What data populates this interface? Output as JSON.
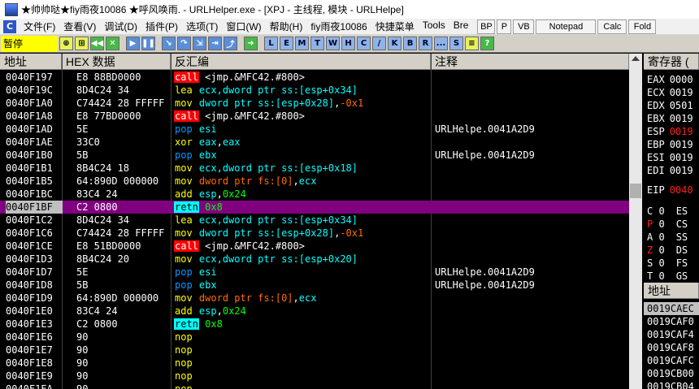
{
  "title": "★帅帅哒★fiy雨夜10086 ★呼风唤雨. - URLHelper.exe - [XPJ - 主线程, 模块 - URLHelpe]",
  "menu": {
    "items": [
      "文件(F)",
      "查看(V)",
      "调试(D)",
      "插件(P)",
      "选项(T)",
      "窗口(W)",
      "帮助(H)",
      "fiy雨夜10086",
      "快捷菜单",
      "Tools",
      "Bre"
    ],
    "right_buttons": [
      "BP",
      "P",
      "VB",
      "Notepad",
      "Calc",
      "Fold"
    ]
  },
  "toolbar": {
    "status": "暂停",
    "letter_buttons": [
      "L",
      "E",
      "M",
      "T",
      "W",
      "H",
      "C",
      "/",
      "K",
      "B",
      "R",
      "...",
      "S"
    ]
  },
  "headers": {
    "address": "地址",
    "hex": "HEX 数据",
    "disasm": "反汇编",
    "comment": "注释",
    "registers": "寄存器 (",
    "stack": "地址"
  },
  "colors": {
    "selected_row": "#800080",
    "call_bg": "#ff0000",
    "retn_bg": "#00ffff",
    "pause_bg": "#ffff00"
  },
  "disasm_rows": [
    {
      "addr": "0040F197",
      "hex": "E8 88BD0000",
      "mn": "call",
      "kind": "call",
      "ops": [
        [
          "<jmp.&MFC42.#800>",
          "txt"
        ]
      ],
      "cmt": ""
    },
    {
      "addr": "0040F19C",
      "hex": "8D4C24 34",
      "mn": "lea",
      "kind": "def",
      "ops": [
        [
          "ecx",
          "reg"
        ],
        [
          ",dword ptr ss:[esp+0x34]",
          "reg"
        ]
      ],
      "cmt": ""
    },
    {
      "addr": "0040F1A0",
      "hex": "C74424 28 FFFFF",
      "mn": "mov",
      "kind": "def",
      "ops": [
        [
          "dword ptr ss:[esp+0x28]",
          "reg"
        ],
        [
          ",",
          "txt"
        ],
        [
          "-0x1",
          "neg"
        ]
      ],
      "cmt": ""
    },
    {
      "addr": "0040F1A8",
      "hex": "E8 77BD0000",
      "mn": "call",
      "kind": "call",
      "ops": [
        [
          "<jmp.&MFC42.#800>",
          "txt"
        ]
      ],
      "cmt": ""
    },
    {
      "addr": "0040F1AD",
      "hex": "5E",
      "mn": "pop",
      "kind": "pop",
      "ops": [
        [
          "esi",
          "reg"
        ]
      ],
      "cmt": "URLHelpe.0041A2D9"
    },
    {
      "addr": "0040F1AE",
      "hex": "33C0",
      "mn": "xor",
      "kind": "def",
      "ops": [
        [
          "eax",
          "reg"
        ],
        [
          ",",
          "txt"
        ],
        [
          "eax",
          "reg"
        ]
      ],
      "cmt": ""
    },
    {
      "addr": "0040F1B0",
      "hex": "5B",
      "mn": "pop",
      "kind": "pop",
      "ops": [
        [
          "ebx",
          "reg"
        ]
      ],
      "cmt": "URLHelpe.0041A2D9"
    },
    {
      "addr": "0040F1B1",
      "hex": "8B4C24 18",
      "mn": "mov",
      "kind": "def",
      "ops": [
        [
          "ecx",
          "reg"
        ],
        [
          ",dword ptr ss:[esp+0x18]",
          "reg"
        ]
      ],
      "cmt": ""
    },
    {
      "addr": "0040F1B5",
      "hex": "64:890D 000000",
      "mn": "mov",
      "kind": "def",
      "ops": [
        [
          "dword ptr fs:[0]",
          "neg"
        ],
        [
          ",",
          "txt"
        ],
        [
          "ecx",
          "reg"
        ]
      ],
      "cmt": ""
    },
    {
      "addr": "0040F1BC",
      "hex": "83C4 24",
      "mn": "add",
      "kind": "def",
      "ops": [
        [
          "esp",
          "reg"
        ],
        [
          ",",
          "txt"
        ],
        [
          "0x24",
          "num"
        ]
      ],
      "cmt": ""
    },
    {
      "addr": "0040F1BF",
      "hex": "C2 0800",
      "mn": "retn",
      "kind": "ret",
      "ops": [
        [
          "0x8",
          "num"
        ]
      ],
      "cmt": "",
      "selected": true
    },
    {
      "addr": "0040F1C2",
      "hex": "8D4C24 34",
      "mn": "lea",
      "kind": "def",
      "ops": [
        [
          "ecx",
          "reg"
        ],
        [
          ",dword ptr ss:[esp+0x34]",
          "reg"
        ]
      ],
      "cmt": ""
    },
    {
      "addr": "0040F1C6",
      "hex": "C74424 28 FFFFF",
      "mn": "mov",
      "kind": "def",
      "ops": [
        [
          "dword ptr ss:[esp+0x28]",
          "reg"
        ],
        [
          ",",
          "txt"
        ],
        [
          "-0x1",
          "neg"
        ]
      ],
      "cmt": ""
    },
    {
      "addr": "0040F1CE",
      "hex": "E8 51BD0000",
      "mn": "call",
      "kind": "call",
      "ops": [
        [
          "<jmp.&MFC42.#800>",
          "txt"
        ]
      ],
      "cmt": ""
    },
    {
      "addr": "0040F1D3",
      "hex": "8B4C24 20",
      "mn": "mov",
      "kind": "def",
      "ops": [
        [
          "ecx",
          "reg"
        ],
        [
          ",dword ptr ss:[esp+0x20]",
          "reg"
        ]
      ],
      "cmt": ""
    },
    {
      "addr": "0040F1D7",
      "hex": "5E",
      "mn": "pop",
      "kind": "pop",
      "ops": [
        [
          "esi",
          "reg"
        ]
      ],
      "cmt": "URLHelpe.0041A2D9"
    },
    {
      "addr": "0040F1D8",
      "hex": "5B",
      "mn": "pop",
      "kind": "pop",
      "ops": [
        [
          "ebx",
          "reg"
        ]
      ],
      "cmt": "URLHelpe.0041A2D9"
    },
    {
      "addr": "0040F1D9",
      "hex": "64:890D 000000",
      "mn": "mov",
      "kind": "def",
      "ops": [
        [
          "dword ptr fs:[0]",
          "neg"
        ],
        [
          ",",
          "txt"
        ],
        [
          "ecx",
          "reg"
        ]
      ],
      "cmt": ""
    },
    {
      "addr": "0040F1E0",
      "hex": "83C4 24",
      "mn": "add",
      "kind": "def",
      "ops": [
        [
          "esp",
          "reg"
        ],
        [
          ",",
          "txt"
        ],
        [
          "0x24",
          "num"
        ]
      ],
      "cmt": ""
    },
    {
      "addr": "0040F1E3",
      "hex": "C2 0800",
      "mn": "retn",
      "kind": "ret",
      "ops": [
        [
          "0x8",
          "num"
        ]
      ],
      "cmt": ""
    },
    {
      "addr": "0040F1E6",
      "hex": "90",
      "mn": "nop",
      "kind": "def",
      "ops": [],
      "cmt": ""
    },
    {
      "addr": "0040F1E7",
      "hex": "90",
      "mn": "nop",
      "kind": "def",
      "ops": [],
      "cmt": ""
    },
    {
      "addr": "0040F1E8",
      "hex": "90",
      "mn": "nop",
      "kind": "def",
      "ops": [],
      "cmt": ""
    },
    {
      "addr": "0040F1E9",
      "hex": "90",
      "mn": "nop",
      "kind": "def",
      "ops": [],
      "cmt": ""
    },
    {
      "addr": "0040F1EA",
      "hex": "90",
      "mn": "nop",
      "kind": "def",
      "ops": [],
      "cmt": ""
    }
  ],
  "registers": [
    {
      "name": "EAX",
      "val": "0000",
      "red": false
    },
    {
      "name": "ECX",
      "val": "0019",
      "red": false
    },
    {
      "name": "EDX",
      "val": "0501",
      "red": false
    },
    {
      "name": "EBX",
      "val": "0019",
      "red": false
    },
    {
      "name": "ESP",
      "val": "0019",
      "red": true
    },
    {
      "name": "EBP",
      "val": "0019",
      "red": false
    },
    {
      "name": "ESI",
      "val": "0019",
      "red": false
    },
    {
      "name": "EDI",
      "val": "0019",
      "red": false
    }
  ],
  "eip": {
    "name": "EIP",
    "val": "0040"
  },
  "flags": [
    {
      "flag": "C",
      "val": "0",
      "seg": "ES",
      "red": false
    },
    {
      "flag": "P",
      "val": "0",
      "seg": "CS",
      "red": true
    },
    {
      "flag": "A",
      "val": "0",
      "seg": "SS",
      "red": false
    },
    {
      "flag": "Z",
      "val": "0",
      "seg": "DS",
      "red": true
    },
    {
      "flag": "S",
      "val": "0",
      "seg": "FS",
      "red": false
    },
    {
      "flag": "T",
      "val": "0",
      "seg": "GS",
      "red": false
    }
  ],
  "stack_rows": [
    "0019CAEC",
    "0019CAF0",
    "0019CAF4",
    "0019CAF8",
    "0019CAFC",
    "0019CB00",
    "0019CB04"
  ]
}
